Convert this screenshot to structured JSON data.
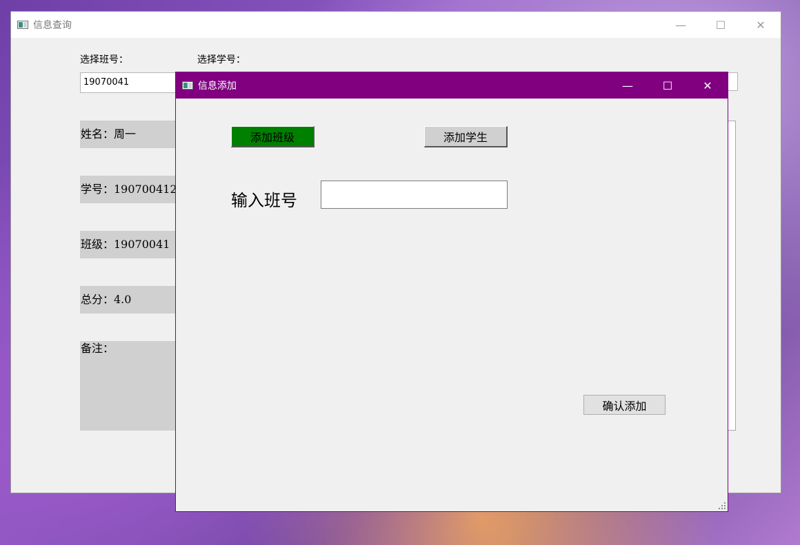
{
  "main_window": {
    "title": "信息查询",
    "controls": {
      "minimize": "—",
      "maximize": "☐",
      "close": "✕"
    },
    "select_class_label": "选择班号：",
    "select_student_label": "选择学号：",
    "class_combo_value": "19070041",
    "fields": {
      "name": "姓名：周一",
      "student_id": "学号：190700412",
      "class": "班级：19070041",
      "total": "总分：4.0",
      "note": "备注："
    }
  },
  "dialog": {
    "title": "信息添加",
    "controls": {
      "minimize": "—",
      "maximize": "☐",
      "close": "✕"
    },
    "add_class_button": "添加班级",
    "add_student_button": "添加学生",
    "input_label": "输入班号",
    "input_value": "",
    "confirm_button": "确认添加"
  },
  "colors": {
    "dialog_accent": "#800080",
    "active_tab_button": "#008000",
    "inactive_button": "#d0d0d0"
  }
}
